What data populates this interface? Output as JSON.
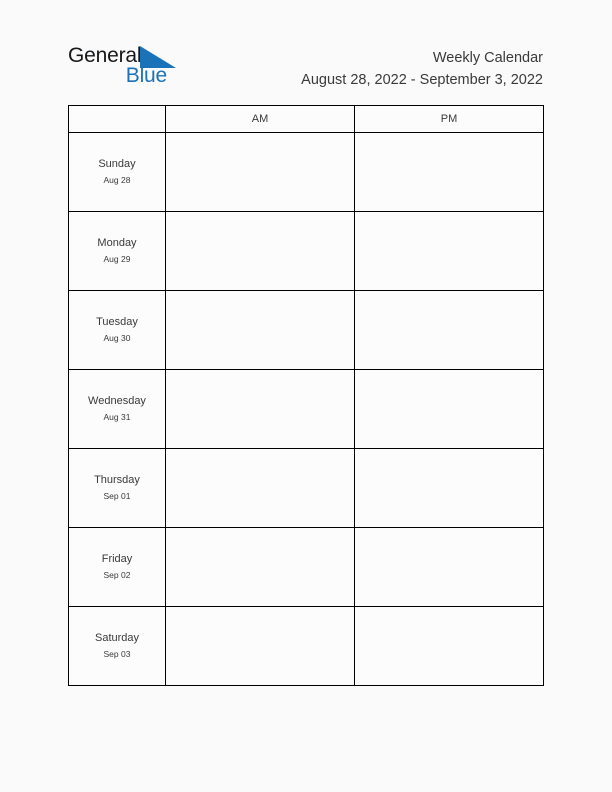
{
  "brand": {
    "word_general": "General",
    "word_blue": "Blue",
    "triangle_color": "#1a72b8",
    "general_color": "#16181a",
    "blue_color": "#1a72b8"
  },
  "header": {
    "title": "Weekly Calendar",
    "date_range": "August 28, 2022 - September 3, 2022"
  },
  "table": {
    "columns": [
      {
        "label": ""
      },
      {
        "label": "AM"
      },
      {
        "label": "PM"
      }
    ],
    "rows": [
      {
        "day": "Sunday",
        "date": "Aug 28",
        "am": "",
        "pm": ""
      },
      {
        "day": "Monday",
        "date": "Aug 29",
        "am": "",
        "pm": ""
      },
      {
        "day": "Tuesday",
        "date": "Aug 30",
        "am": "",
        "pm": ""
      },
      {
        "day": "Wednesday",
        "date": "Aug 31",
        "am": "",
        "pm": ""
      },
      {
        "day": "Thursday",
        "date": "Sep 01",
        "am": "",
        "pm": ""
      },
      {
        "day": "Friday",
        "date": "Sep 02",
        "am": "",
        "pm": ""
      },
      {
        "day": "Saturday",
        "date": "Sep 03",
        "am": "",
        "pm": ""
      }
    ]
  }
}
